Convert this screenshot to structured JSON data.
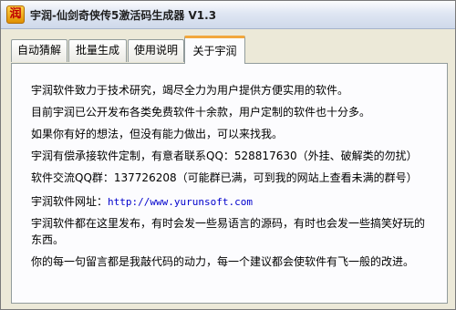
{
  "window": {
    "title": "宇润-仙剑奇侠传5激活码生成器 V1.3",
    "icon": "app-logo-icon",
    "icon_glyph": "润"
  },
  "tabs": [
    {
      "label": "自动猜解",
      "active": false
    },
    {
      "label": "批量生成",
      "active": false
    },
    {
      "label": "使用说明",
      "active": false
    },
    {
      "label": "关于宇润",
      "active": true
    }
  ],
  "about": {
    "p1": "宇润软件致力于技术研究，竭尽全力为用户提供方便实用的软件。",
    "p2": "目前宇润已公开发布各类免费软件十余款，用户定制的软件也十分多。",
    "p3": "如果你有好的想法，但没有能力做出，可以来找我。",
    "p4": "宇润有偿承接软件定制，有意者联系QQ：528817630（外挂、破解类的勿扰）",
    "p5": "软件交流QQ群：137726208（可能群已满，可到我的网站上查看未满的群号）",
    "website_label": "宇润软件网址：",
    "website_url": "http://www.yurunsoft.com",
    "p7": "宇润软件都在这里发布，有时会发一些易语言的源码，有时也会发一些搞笑好玩的东西。",
    "p8": "你的每一句留言都是我敲代码的动力，每一个建议都会使软件有飞一般的改进。"
  }
}
